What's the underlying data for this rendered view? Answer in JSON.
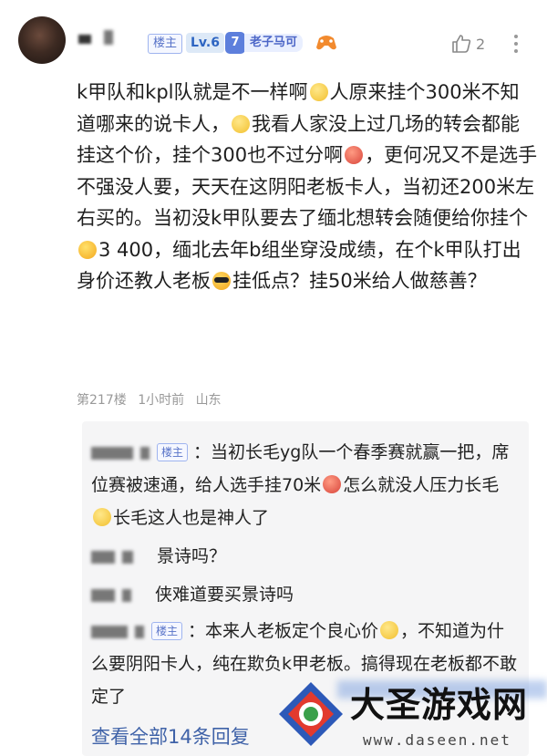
{
  "header": {
    "owner_tag": "楼主",
    "level": "Lv.6",
    "badge_level": "7",
    "badge_name": "老子马可",
    "like_count": "2"
  },
  "post": {
    "lines": [
      [
        "text",
        "k甲队和kpl队就是不一样啊"
      ],
      [
        "emoji",
        "e-yellow"
      ],
      [
        "text",
        "人原来挂个300米不知道哪来的说卡人，"
      ],
      [
        "emoji",
        "e-yellow"
      ],
      [
        "text",
        "我看人家没上过几场的转会都能挂这个价，挂个300也不过分啊"
      ],
      [
        "emoji",
        "e-red"
      ],
      [
        "text",
        "，更何况又不是选手不强没人要，天天在这阴阳老板卡人，当初还200米左右买的。当初没k甲队要去了缅北想转会随便给你挂个"
      ],
      [
        "emoji",
        "e-laugh"
      ],
      [
        "text",
        "3 400，缅北去年b组坐穿没成绩，在个k甲队打出身价还教人老板"
      ],
      [
        "emoji",
        "e-cool"
      ],
      [
        "text",
        "挂低点？挂50米给人做慈善？"
      ]
    ],
    "meta": {
      "floor": "第217楼",
      "time": "1小时前",
      "location": "山东"
    }
  },
  "replies": [
    {
      "owner_tag": "楼主",
      "parts": [
        [
          "text",
          "当初长毛yg队一个春季赛就赢一把，席位赛被速通，给人选手挂70米"
        ],
        [
          "emoji",
          "e-red"
        ],
        [
          "text",
          "怎么就没人压力长毛"
        ],
        [
          "emoji",
          "e-yellow"
        ],
        [
          "text",
          "长毛这人也是神人了"
        ]
      ]
    },
    {
      "owner_tag": "",
      "parts": [
        [
          "text",
          "景诗吗？"
        ]
      ]
    },
    {
      "owner_tag": "",
      "parts": [
        [
          "text",
          "侠难道要买景诗吗"
        ]
      ]
    },
    {
      "owner_tag": "楼主",
      "parts": [
        [
          "text",
          "本来人老板定个良心价"
        ],
        [
          "emoji",
          "e-yellow"
        ],
        [
          "text",
          "，不知道为什么要阴阳卡人，纯在欺负k甲老板。搞得现在老板都不敢定了"
        ]
      ]
    }
  ],
  "view_all": "查看全部14条回复",
  "watermark": {
    "title": "大圣游戏网",
    "url": "www.daseen.net"
  }
}
